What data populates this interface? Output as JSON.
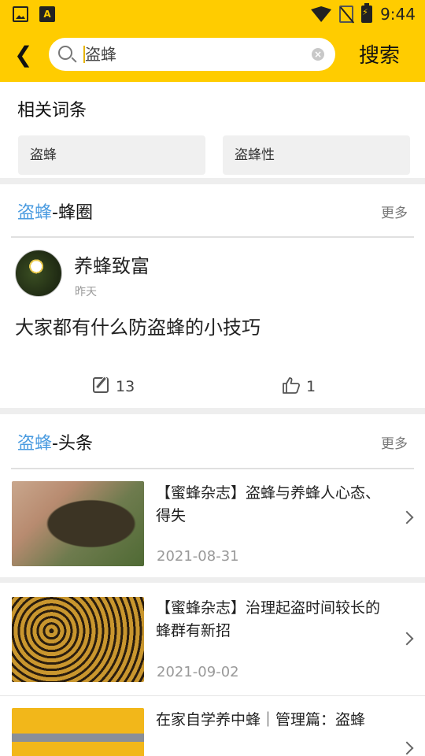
{
  "status_bar": {
    "time": "9:44"
  },
  "search": {
    "query": "盗蜂",
    "button_label": "搜索"
  },
  "related": {
    "title": "相关词条",
    "terms": [
      "盗蜂",
      "盗蜂性"
    ]
  },
  "circle_section": {
    "keyword": "盗蜂",
    "suffix": "-蜂圈",
    "more": "更多",
    "post": {
      "author": "养蜂致富",
      "time": "昨天",
      "text": "大家都有什么防盗蜂的小技巧",
      "comments": "13",
      "likes": "1"
    }
  },
  "news_section": {
    "keyword": "盗蜂",
    "suffix": "-头条",
    "more": "更多",
    "items": [
      {
        "title": "【蜜蜂杂志】盗蜂与养蜂人心态、得失",
        "date": "2021-08-31"
      },
      {
        "title": "【蜜蜂杂志】治理起盗时间较长的蜂群有新招",
        "date": "2021-09-02"
      },
      {
        "title": "在家自学养中蜂｜管理篇：盗蜂",
        "date": ""
      }
    ]
  },
  "colors": {
    "brand_yellow": "#FFCC00",
    "keyword_blue": "#4A9BE0"
  }
}
